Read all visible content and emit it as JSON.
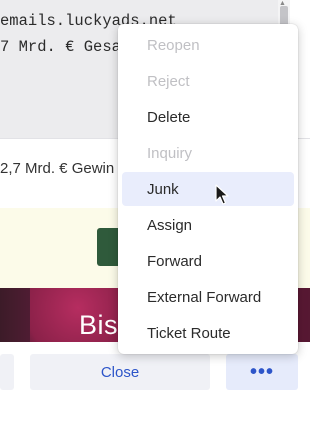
{
  "background": {
    "code_lines": [
      "emails.luckyads.net",
      "7 Mrd. € Gesa"
    ],
    "preview_text": "2,7 Mrd. € Gewin",
    "image_text": "Bis"
  },
  "actions": {
    "close_label": "Close",
    "more_label": "•••"
  },
  "menu": {
    "items": [
      {
        "label": "Reopen",
        "disabled": true
      },
      {
        "label": "Reject",
        "disabled": true
      },
      {
        "label": "Delete",
        "disabled": false
      },
      {
        "label": "Inquiry",
        "disabled": true
      },
      {
        "label": "Junk",
        "disabled": false,
        "hovered": true
      },
      {
        "label": "Assign",
        "disabled": false
      },
      {
        "label": "Forward",
        "disabled": false
      },
      {
        "label": "External Forward",
        "disabled": false
      },
      {
        "label": "Ticket Route",
        "disabled": false
      }
    ]
  },
  "colors": {
    "accent": "#2d55c9",
    "hover_bg": "#e9edfc",
    "disabled_text": "#c0c0c4",
    "banner_button": "#2f5a3b"
  },
  "icons": {
    "cursor": "mouse-pointer-icon",
    "more": "more-dots-icon"
  }
}
